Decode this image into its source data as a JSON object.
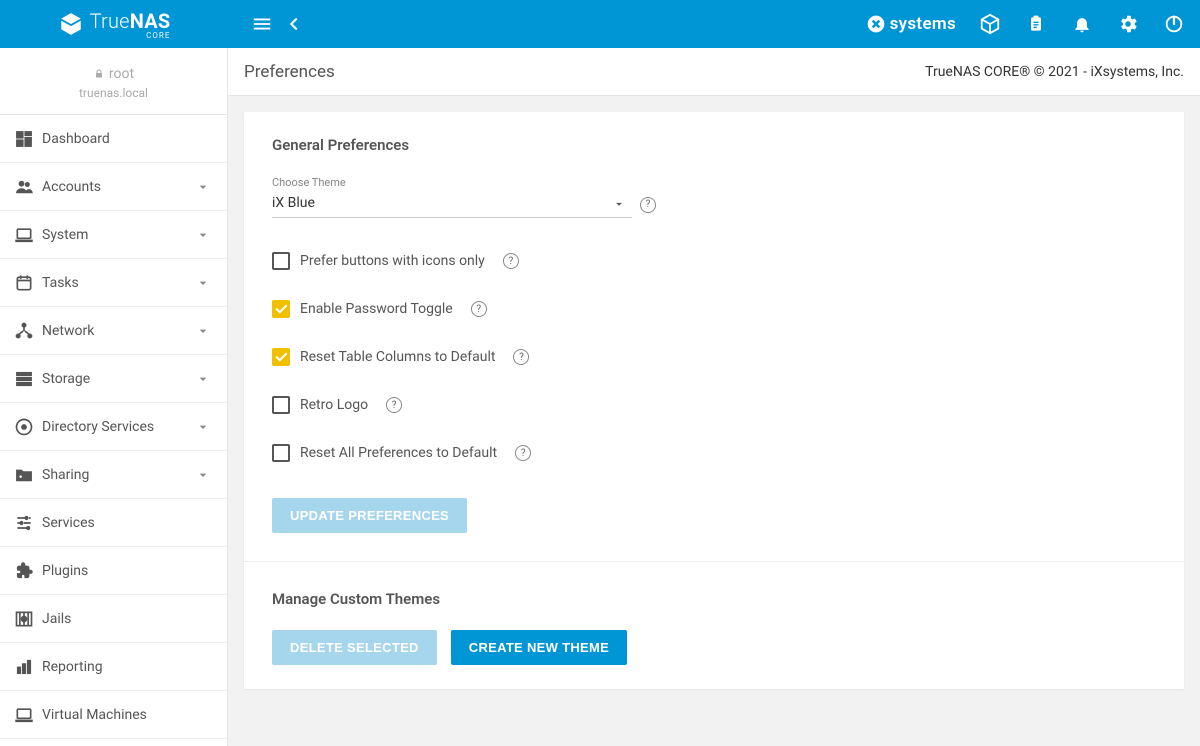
{
  "brand": {
    "name": "TrueNAS",
    "sub": "CORE"
  },
  "topbar": {
    "vendor": "systems"
  },
  "user": {
    "name": "root",
    "host": "truenas.local"
  },
  "nav": {
    "items": [
      {
        "label": "Dashboard",
        "icon": "dashboard",
        "expandable": false
      },
      {
        "label": "Accounts",
        "icon": "people",
        "expandable": true
      },
      {
        "label": "System",
        "icon": "laptop",
        "expandable": true
      },
      {
        "label": "Tasks",
        "icon": "calendar",
        "expandable": true
      },
      {
        "label": "Network",
        "icon": "hub",
        "expandable": true
      },
      {
        "label": "Storage",
        "icon": "storage",
        "expandable": true
      },
      {
        "label": "Directory Services",
        "icon": "album",
        "expandable": true
      },
      {
        "label": "Sharing",
        "icon": "folder",
        "expandable": true
      },
      {
        "label": "Services",
        "icon": "tune",
        "expandable": false
      },
      {
        "label": "Plugins",
        "icon": "extension",
        "expandable": false
      },
      {
        "label": "Jails",
        "icon": "jails",
        "expandable": false
      },
      {
        "label": "Reporting",
        "icon": "chart",
        "expandable": false
      },
      {
        "label": "Virtual Machines",
        "icon": "laptop",
        "expandable": false
      }
    ]
  },
  "page": {
    "title": "Preferences",
    "copyright": "TrueNAS CORE® © 2021 - iXsystems, Inc."
  },
  "prefs": {
    "heading": "General Preferences",
    "theme_label": "Choose Theme",
    "theme_value": "iX Blue",
    "options": [
      {
        "label": "Prefer buttons with icons only",
        "checked": false
      },
      {
        "label": "Enable Password Toggle",
        "checked": true
      },
      {
        "label": "Reset Table Columns to Default",
        "checked": true
      },
      {
        "label": "Retro Logo",
        "checked": false
      },
      {
        "label": "Reset All Preferences to Default",
        "checked": false
      }
    ],
    "update_btn": "Update Preferences"
  },
  "themes": {
    "heading": "Manage Custom Themes",
    "delete_btn": "Delete Selected",
    "create_btn": "Create New Theme"
  }
}
